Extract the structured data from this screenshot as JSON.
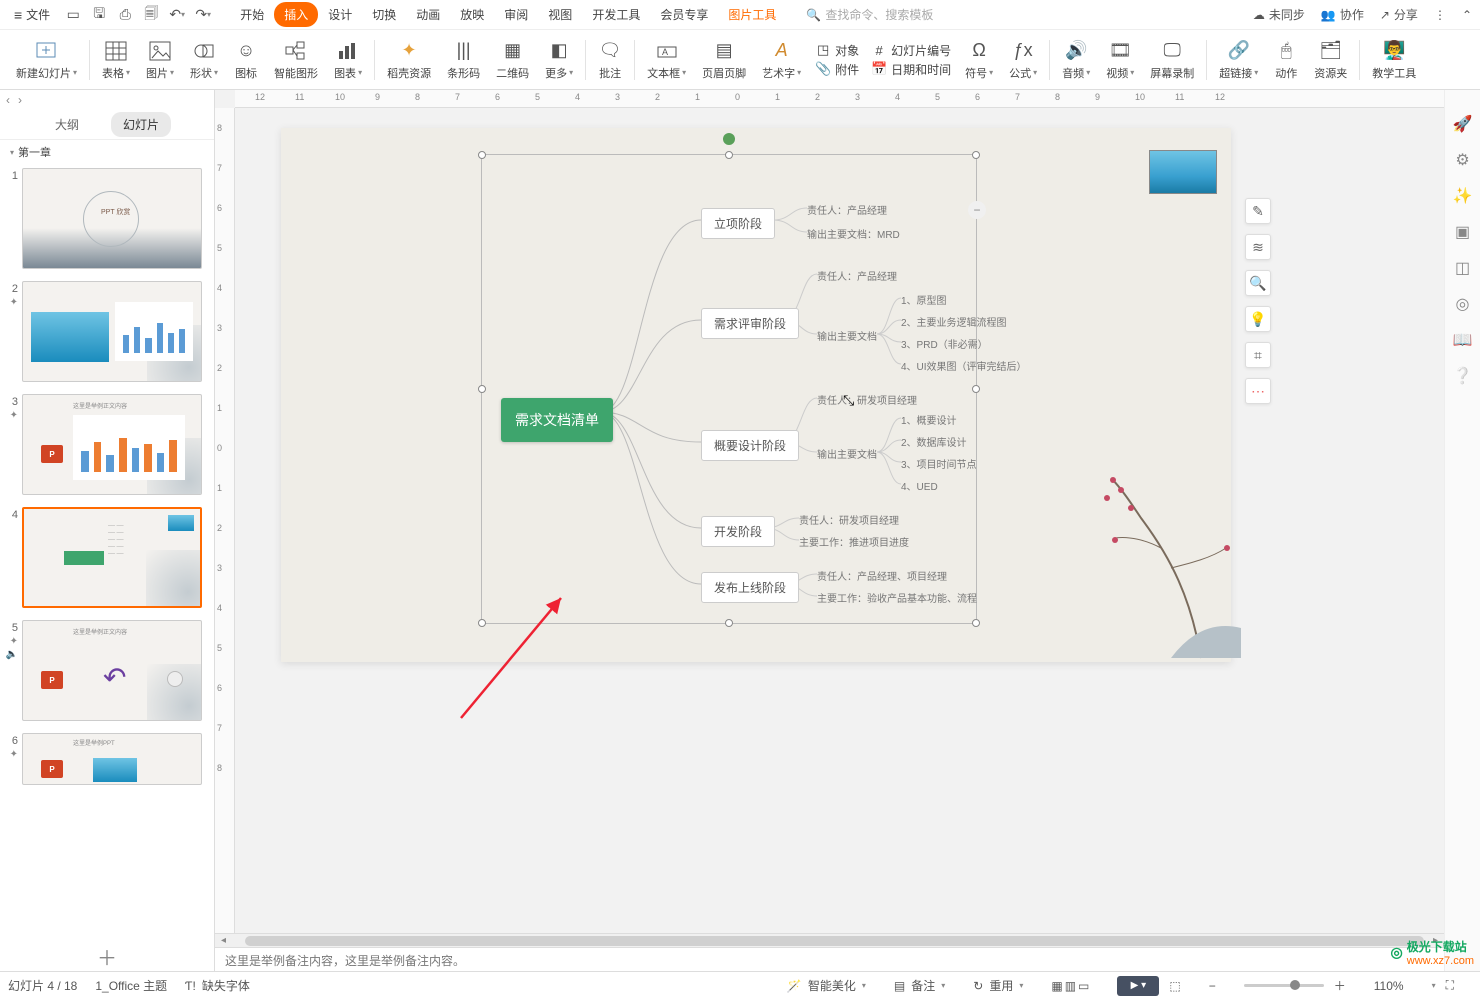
{
  "menu": {
    "file": "文件",
    "tabs": [
      "开始",
      "插入",
      "设计",
      "切换",
      "动画",
      "放映",
      "审阅",
      "视图",
      "开发工具",
      "会员专享"
    ],
    "context_tab": "图片工具",
    "search_placeholder": "查找命令、搜索模板",
    "sync": "未同步",
    "coop": "协作",
    "share": "分享"
  },
  "ribbon": {
    "new_slide": "新建幻灯片",
    "table": "表格",
    "image": "图片",
    "shape": "形状",
    "icon": "图标",
    "smartart": "智能图形",
    "chart": "图表",
    "resource": "稻壳资源",
    "barcode": "条形码",
    "qrcode": "二维码",
    "more": "更多",
    "comment": "批注",
    "textbox": "文本框",
    "header_footer": "页眉页脚",
    "wordart": "艺术字",
    "object": "对象",
    "attachment": "附件",
    "slide_number": "幻灯片编号",
    "date_time": "日期和时间",
    "symbol": "符号",
    "formula": "公式",
    "audio": "音频",
    "video": "视频",
    "screen_record": "屏幕录制",
    "hyperlink": "超链接",
    "action": "动作",
    "resource_pane": "资源夹",
    "teach_tool": "教学工具"
  },
  "left": {
    "tab_outline": "大纲",
    "tab_slides": "幻灯片",
    "chapter": "第一章"
  },
  "mindmap": {
    "root": "需求文档清单",
    "n1": "立项阶段",
    "n1a": "责任人：产品经理",
    "n1b": "输出主要文档：MRD",
    "n2": "需求评审阶段",
    "n2a": "责任人：产品经理",
    "n2b": "输出主要文档",
    "n2b1": "1、原型图",
    "n2b2": "2、主要业务逻辑流程图",
    "n2b3": "3、PRD（非必需）",
    "n2b4": "4、UI效果图（评审完结后）",
    "n3": "概要设计阶段",
    "n3a": "责任人：研发项目经理",
    "n3b": "输出主要文档",
    "n3b1": "1、概要设计",
    "n3b2": "2、数据库设计",
    "n3b3": "3、项目时间节点",
    "n3b4": "4、UED",
    "n4": "开发阶段",
    "n4a": "责任人：研发项目经理",
    "n4b": "主要工作：推进项目进度",
    "n5": "发布上线阶段",
    "n5a": "责任人：产品经理、项目经理",
    "n5b": "主要工作：验收产品基本功能、流程"
  },
  "notes": "这里是举例备注内容，这里是举例备注内容。",
  "status": {
    "page": "幻灯片 4 / 18",
    "theme": "1_Office 主题",
    "missing_font": "缺失字体",
    "beautify": "智能美化",
    "notes_btn": "备注",
    "reuse": "重用",
    "zoom": "110%"
  },
  "watermark": {
    "brand": "极光下载站",
    "url": "www.xz7.com"
  },
  "ruler_h": [
    "12",
    "11",
    "10",
    "9",
    "8",
    "7",
    "6",
    "5",
    "4",
    "3",
    "2",
    "1",
    "0",
    "1",
    "2",
    "3",
    "4",
    "5",
    "6",
    "7",
    "8",
    "9",
    "10",
    "11",
    "12"
  ],
  "ruler_v": [
    "8",
    "7",
    "6",
    "5",
    "4",
    "3",
    "2",
    "1",
    "0",
    "1",
    "2",
    "3",
    "4",
    "5",
    "6",
    "7",
    "8"
  ]
}
